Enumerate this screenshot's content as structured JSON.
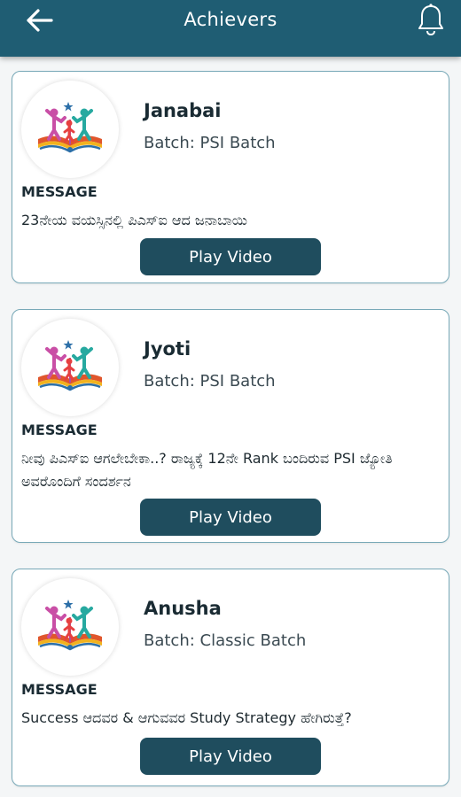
{
  "app_bar": {
    "title": "Achievers",
    "back_icon": "arrow-left-icon",
    "bell_icon": "bell-icon"
  },
  "colors": {
    "app_bar": "#1f5d73",
    "button": "#1f4d5e",
    "card_border": "#78a9b8"
  },
  "achievers": [
    {
      "name": "Janabai",
      "batch": "Batch: PSI Batch",
      "message_label": "MESSAGE",
      "message": "23ನೇಯ ವಯಸ್ಸಿನಲ್ಲಿ ಪಿಎಸ್ಐ ಆದ ಜನಾಬಾಯಿ",
      "button_label": "Play Video"
    },
    {
      "name": "Jyoti",
      "batch": "Batch: PSI Batch",
      "message_label": "MESSAGE",
      "message": "ನೀವು ಪಿಎಸ್ಐ ಆಗಲೇಬೇಕಾ..? ರಾಜ್ಯಕ್ಕೆ 12ನೇ Rank ಬಂದಿರುವ PSI ಜ್ಯೋತಿ ಅವರೊಂದಿಗೆ ಸಂದರ್ಶನ",
      "button_label": "Play Video"
    },
    {
      "name": "Anusha",
      "batch": "Batch: Classic Batch",
      "message_label": "MESSAGE",
      "message": "Success ಆದವರ & ಆಗುವವರ Study Strategy ಹೇಗಿರುತ್ತೆ?",
      "button_label": "Play Video"
    }
  ]
}
